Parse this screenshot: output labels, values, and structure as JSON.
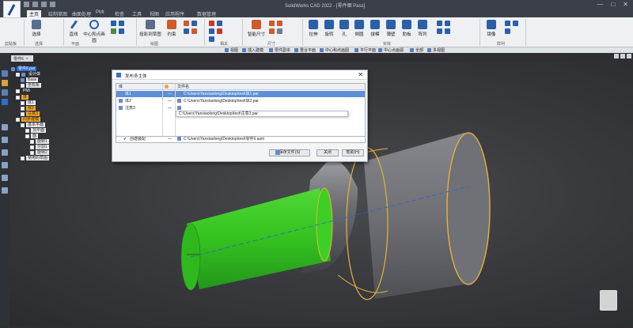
{
  "window": {
    "title": "SolidWorks CAD 2022 - [零件图 Pass]",
    "controls": [
      "—",
      "□",
      "✕"
    ]
  },
  "ribbon_tabs": [
    {
      "label": "主页",
      "active": true
    },
    {
      "label": "绘制草图",
      "active": false
    },
    {
      "label": "曲面处理",
      "active": false
    },
    {
      "label": "PMI",
      "active": false
    },
    {
      "label": "检查",
      "active": false
    },
    {
      "label": "工具",
      "active": false
    },
    {
      "label": "视图",
      "active": false
    },
    {
      "label": "应用程序",
      "active": false
    },
    {
      "label": "数据管理",
      "active": false
    }
  ],
  "ribbon": {
    "buttons": [
      {
        "label": "选择",
        "color": "#5a6f8f"
      },
      {
        "label": "直线",
        "color": "#2b5fa8"
      },
      {
        "label": "中心和点画圆",
        "color": "#2b5fa8"
      },
      {
        "label": "投影到草图",
        "color": "#5d6c86"
      },
      {
        "label": "约束",
        "color": "#cf5a2a"
      },
      {
        "label": "智能尺寸",
        "color": "#cf5a2a"
      },
      {
        "label": "拉伸",
        "color": "#2b5fa8"
      },
      {
        "label": "旋转",
        "color": "#2b5fa8"
      },
      {
        "label": "孔",
        "color": "#2b5fa8"
      },
      {
        "label": "倒圆",
        "color": "#2b5fa8"
      },
      {
        "label": "拔模",
        "color": "#2b5fa8"
      },
      {
        "label": "薄壁",
        "color": "#2b5fa8"
      },
      {
        "label": "肋板",
        "color": "#2b5fa8"
      },
      {
        "label": "阵列",
        "color": "#2b5fa8"
      },
      {
        "label": "镜像",
        "color": "#2b5fa8"
      }
    ],
    "groups": [
      "剪贴板",
      "选择",
      "平面",
      "绘图",
      "相关",
      "尺寸",
      "实体",
      "阵列"
    ]
  },
  "command_bar": [
    "视图",
    "插入建模",
    "零件副本",
    "重合平面",
    "中心和点画圆",
    "平行平面",
    "中心点画弧",
    "全部",
    "多视图"
  ],
  "document_tab": {
    "label": "零件6",
    "close": "×"
  },
  "feature_tree": {
    "items": [
      {
        "label": "零件6.par",
        "level": 0,
        "style": "blue"
      },
      {
        "label": "设计体",
        "level": 1,
        "style": ""
      },
      {
        "label": "Base",
        "level": 2,
        "style": "white"
      },
      {
        "label": "坐标系",
        "level": 2,
        "style": "white"
      },
      {
        "label": "PMI",
        "level": 1,
        "style": ""
      },
      {
        "label": "体",
        "level": 1,
        "style": "orange"
      },
      {
        "label": "体1",
        "level": 2,
        "style": "white"
      },
      {
        "label": "体2",
        "level": 2,
        "style": "orange"
      },
      {
        "label": "注意3",
        "level": 2,
        "style": "orange"
      },
      {
        "label": "同步建模",
        "level": 1,
        "style": "orange"
      },
      {
        "label": "基本平面",
        "level": 2,
        "style": "white"
      },
      {
        "label": "顶平面",
        "level": 3,
        "style": "white"
      },
      {
        "label": "面",
        "level": 3,
        "style": "white"
      },
      {
        "label": "旋转1",
        "level": 4,
        "style": "white"
      },
      {
        "label": "分割1",
        "level": 4,
        "style": "white"
      },
      {
        "label": "旋转2",
        "level": 4,
        "style": "white"
      },
      {
        "label": "使用的草图",
        "level": 2,
        "style": "white"
      }
    ]
  },
  "dialog": {
    "title": "发布多主体",
    "close": "✕",
    "headers": {
      "body": "体",
      "file": "文件名"
    },
    "rows": [
      {
        "body": "体1",
        "dash": "—",
        "path": "C:\\Users\\Yanxiaolong\\Desktop\\test\\体1.par",
        "selected": true
      },
      {
        "body": "体2",
        "dash": "—",
        "path": "C:\\Users\\Yanxiaolong\\Desktop\\test\\体2.par",
        "selected": false
      },
      {
        "body": "注意3",
        "dash": "—",
        "path": "C:\\Users\\Yanxiaolong\\Desktop\\test\\注意3.par",
        "selected": false
      }
    ],
    "popup_path": "C:\\Users\\Yanxiaolong\\Desktop\\test\\注意3.par",
    "assembly": {
      "checked": "✔",
      "label": "创建装配",
      "dash": "—",
      "path": "C:\\Users\\Yanxiaolong\\Desktop\\test\\零件6.asm"
    },
    "buttons": {
      "save": "保存文件(S)",
      "close": "关闭",
      "help": "帮助(H)"
    }
  },
  "colors": {
    "accent_blue": "#2d6fd0",
    "tree_orange": "#f0a52a",
    "cylinder_green": "#34c21f",
    "edge_orange": "#e8b13a"
  }
}
